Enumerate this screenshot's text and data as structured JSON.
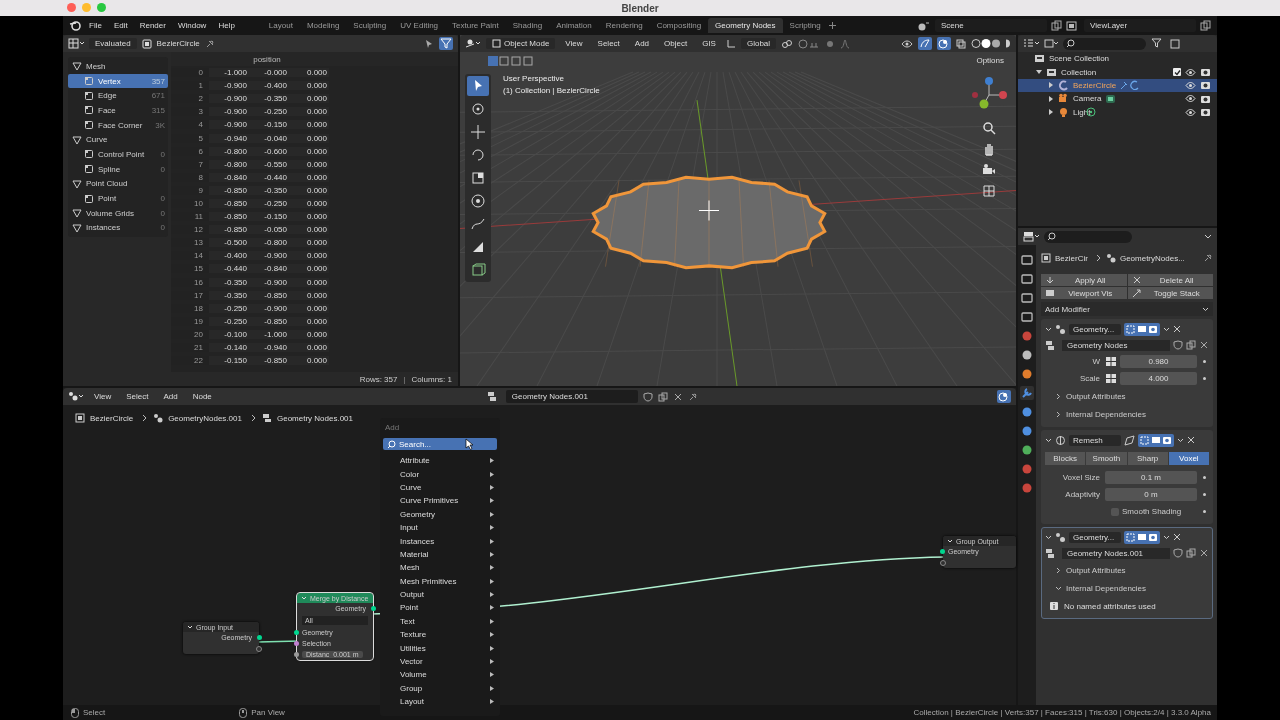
{
  "window": {
    "title": "Blender"
  },
  "menu": [
    "File",
    "Edit",
    "Render",
    "Window",
    "Help"
  ],
  "workspaces": [
    {
      "label": "Layout",
      "selected": false
    },
    {
      "label": "Modeling",
      "selected": false
    },
    {
      "label": "Sculpting",
      "selected": false
    },
    {
      "label": "UV Editing",
      "selected": false
    },
    {
      "label": "Texture Paint",
      "selected": false
    },
    {
      "label": "Shading",
      "selected": false
    },
    {
      "label": "Animation",
      "selected": false
    },
    {
      "label": "Rendering",
      "selected": false
    },
    {
      "label": "Compositing",
      "selected": false
    },
    {
      "label": "Geometry Nodes",
      "selected": true
    },
    {
      "label": "Scripting",
      "selected": false
    }
  ],
  "scene": "Scene",
  "view_layer": "ViewLayer",
  "spreadsheet": {
    "mode": "Evaluated",
    "object": "BezierCircle",
    "column": "position",
    "domains": [
      {
        "label": "Mesh",
        "kind": "geometry",
        "selected": false
      },
      {
        "label": "Vertex",
        "count": "357",
        "kind": "domain",
        "selected": true
      },
      {
        "label": "Edge",
        "count": "671",
        "kind": "domain",
        "selected": false
      },
      {
        "label": "Face",
        "count": "315",
        "kind": "domain",
        "selected": false
      },
      {
        "label": "Face Corner",
        "count": "3K",
        "kind": "domain",
        "selected": false
      },
      {
        "label": "Curve",
        "kind": "geometry",
        "selected": false
      },
      {
        "label": "Control Point",
        "count": "0",
        "kind": "domain",
        "selected": false
      },
      {
        "label": "Spline",
        "count": "0",
        "kind": "domain",
        "selected": false
      },
      {
        "label": "Point Cloud",
        "kind": "geometry",
        "selected": false
      },
      {
        "label": "Point",
        "count": "0",
        "kind": "domain",
        "selected": false
      },
      {
        "label": "Volume Grids",
        "count": "0",
        "kind": "geometry",
        "selected": false
      },
      {
        "label": "Instances",
        "count": "0",
        "kind": "geometry",
        "selected": false
      }
    ],
    "rows": [
      [
        "0",
        "-1.000",
        "-0.000",
        "0.000"
      ],
      [
        "1",
        "-0.900",
        "-0.400",
        "0.000"
      ],
      [
        "2",
        "-0.900",
        "-0.350",
        "0.000"
      ],
      [
        "3",
        "-0.900",
        "-0.250",
        "0.000"
      ],
      [
        "4",
        "-0.900",
        "-0.150",
        "0.000"
      ],
      [
        "5",
        "-0.940",
        "-0.040",
        "0.000"
      ],
      [
        "6",
        "-0.800",
        "-0.600",
        "0.000"
      ],
      [
        "7",
        "-0.800",
        "-0.550",
        "0.000"
      ],
      [
        "8",
        "-0.840",
        "-0.440",
        "0.000"
      ],
      [
        "9",
        "-0.850",
        "-0.350",
        "0.000"
      ],
      [
        "10",
        "-0.850",
        "-0.250",
        "0.000"
      ],
      [
        "11",
        "-0.850",
        "-0.150",
        "0.000"
      ],
      [
        "12",
        "-0.850",
        "-0.050",
        "0.000"
      ],
      [
        "13",
        "-0.500",
        "-0.800",
        "0.000"
      ],
      [
        "14",
        "-0.400",
        "-0.900",
        "0.000"
      ],
      [
        "15",
        "-0.440",
        "-0.840",
        "0.000"
      ],
      [
        "16",
        "-0.350",
        "-0.900",
        "0.000"
      ],
      [
        "17",
        "-0.350",
        "-0.850",
        "0.000"
      ],
      [
        "18",
        "-0.250",
        "-0.900",
        "0.000"
      ],
      [
        "19",
        "-0.250",
        "-0.850",
        "0.000"
      ],
      [
        "20",
        "-0.100",
        "-1.000",
        "0.000"
      ],
      [
        "21",
        "-0.140",
        "-0.940",
        "0.000"
      ],
      [
        "22",
        "-0.150",
        "-0.850",
        "0.000"
      ]
    ],
    "footer": [
      "Rows: 357",
      "|",
      "Columns: 1"
    ]
  },
  "viewport": {
    "mode": "Object Mode",
    "menu": [
      "View",
      "Select",
      "Add",
      "Object",
      "GIS"
    ],
    "orientation": "Global",
    "options": "Options",
    "info": [
      "User Perspective",
      "(1) Collection | BezierCircle"
    ]
  },
  "outliner": {
    "items": [
      {
        "label": "Scene Collection",
        "kind": "collection",
        "selected": false,
        "children": [
          {
            "label": "Collection",
            "kind": "collection",
            "expanded": true,
            "checked": true,
            "selected": false,
            "children": [
              {
                "label": "BezierCircle",
                "kind": "curve",
                "expanded": false,
                "selected": true
              },
              {
                "label": "Camera",
                "kind": "camera",
                "expanded": false,
                "selected": false
              },
              {
                "label": "Light",
                "kind": "light",
                "expanded": false,
                "selected": false
              }
            ]
          }
        ]
      }
    ]
  },
  "properties": {
    "breadcrumb": [
      "BezierCir",
      "GeometryNodes..."
    ],
    "buttons": [
      "Apply All",
      "Delete All",
      "Viewport Vis",
      "Toggle Stack"
    ],
    "add_modifier": "Add Modifier",
    "modifiers": [
      {
        "kind": "nodes",
        "name": "Geometry...",
        "active": false,
        "group": "Geometry Nodes",
        "inputs": [
          {
            "label": "W",
            "value": "0.980"
          },
          {
            "label": "Scale",
            "value": "4.000"
          }
        ],
        "sections": [
          {
            "label": "Output Attributes",
            "expanded": false
          },
          {
            "label": "Internal Dependencies",
            "expanded": false
          }
        ]
      },
      {
        "kind": "remesh",
        "name": "Remesh",
        "active": false,
        "modes": [
          {
            "label": "Blocks",
            "selected": false
          },
          {
            "label": "Smooth",
            "selected": false
          },
          {
            "label": "Sharp",
            "selected": false
          },
          {
            "label": "Voxel",
            "selected": true
          }
        ],
        "fields": [
          {
            "label": "Voxel Size",
            "value": "0.1 m"
          },
          {
            "label": "Adaptivity",
            "value": "0 m"
          }
        ],
        "option": {
          "label": "Smooth Shading",
          "checked": false
        }
      },
      {
        "kind": "nodes",
        "name": "Geometry...",
        "active": true,
        "group": "Geometry Nodes.001",
        "sections": [
          {
            "label": "Output Attributes",
            "expanded": false
          },
          {
            "label": "Internal Dependencies",
            "expanded": true
          }
        ],
        "message": "No named attributes used"
      }
    ]
  },
  "node_editor": {
    "menu": [
      "View",
      "Select",
      "Add",
      "Node"
    ],
    "tree": "Geometry Nodes.001",
    "breadcrumb": [
      "BezierCircle",
      "GeometryNodes.001",
      "Geometry Nodes.001"
    ],
    "add_menu": {
      "title": "Add",
      "search": "Search...",
      "items": [
        "Attribute",
        "Color",
        "Curve",
        "Curve Primitives",
        "Geometry",
        "Input",
        "Instances",
        "Material",
        "Mesh",
        "Mesh Primitives",
        "Output",
        "Point",
        "Text",
        "Texture",
        "Utilities",
        "Vector",
        "Volume",
        "Group",
        "Layout"
      ]
    },
    "nodes": [
      {
        "kind": "group_input",
        "title": "Group Input",
        "outputs": [
          "Geometry"
        ]
      },
      {
        "kind": "merge",
        "title": "Merge by Distance",
        "outputs": [
          "Geometry"
        ],
        "mode": "All",
        "inputs": [
          "Geometry",
          "Selection"
        ],
        "field": {
          "label": "Distanc",
          "value": "0.001 m"
        }
      },
      {
        "kind": "group_output",
        "title": "Group Output",
        "inputs": [
          "Geometry"
        ]
      }
    ]
  },
  "status_bar": {
    "hints": [
      "Select",
      "Pan View"
    ],
    "stats": "Collection | BezierCircle | Verts:357 | Faces:315 | Tris:630 | Objects:2/4 | 3.3.0 Alpha"
  }
}
